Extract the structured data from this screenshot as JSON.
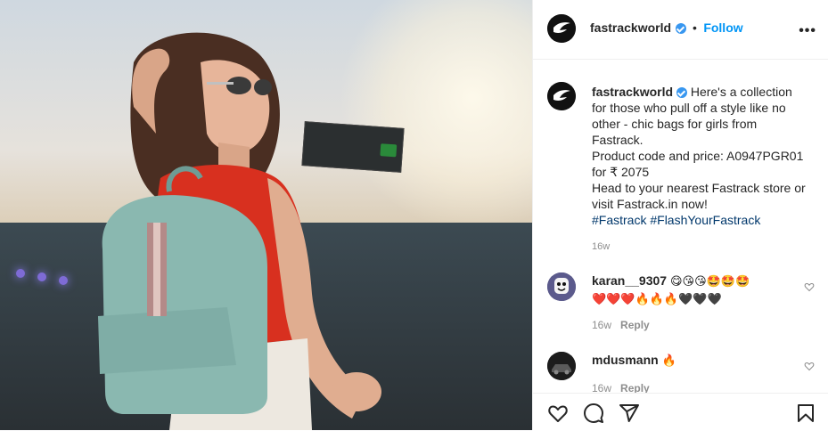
{
  "post": {
    "username": "fastrackworld",
    "follow_label": "Follow",
    "more_label": "•••",
    "separator": "•"
  },
  "caption": {
    "username": "fastrackworld",
    "lines": [
      "Here's a collection",
      "for those who pull off a style like no",
      "other - chic bags for girls from",
      "Fastrack.",
      "Product code and price: A0947PGR01",
      "for ₹ 2075",
      "Head to your nearest Fastrack store or",
      "visit Fastrack.in now!"
    ],
    "hashtags": [
      "#Fastrack",
      "#FlashYourFastrack"
    ],
    "time": "16w"
  },
  "comments": [
    {
      "username": "karan__9307",
      "text_line1": "😋😘😘🤩🤩🤩",
      "text_line2": "❤️❤️❤️🔥🔥🔥🖤🖤🖤",
      "time": "16w",
      "reply_label": "Reply"
    },
    {
      "username": "mdusmann",
      "text_line1": "🔥",
      "time": "16w",
      "reply_label": "Reply"
    }
  ],
  "actions": [
    "heart-icon",
    "comment-icon",
    "share-icon",
    "bookmark-icon"
  ],
  "colors": {
    "follow": "#0095f6",
    "hashtag": "#00376b",
    "verified": "#3897f0",
    "muted": "#8e8e8e"
  }
}
